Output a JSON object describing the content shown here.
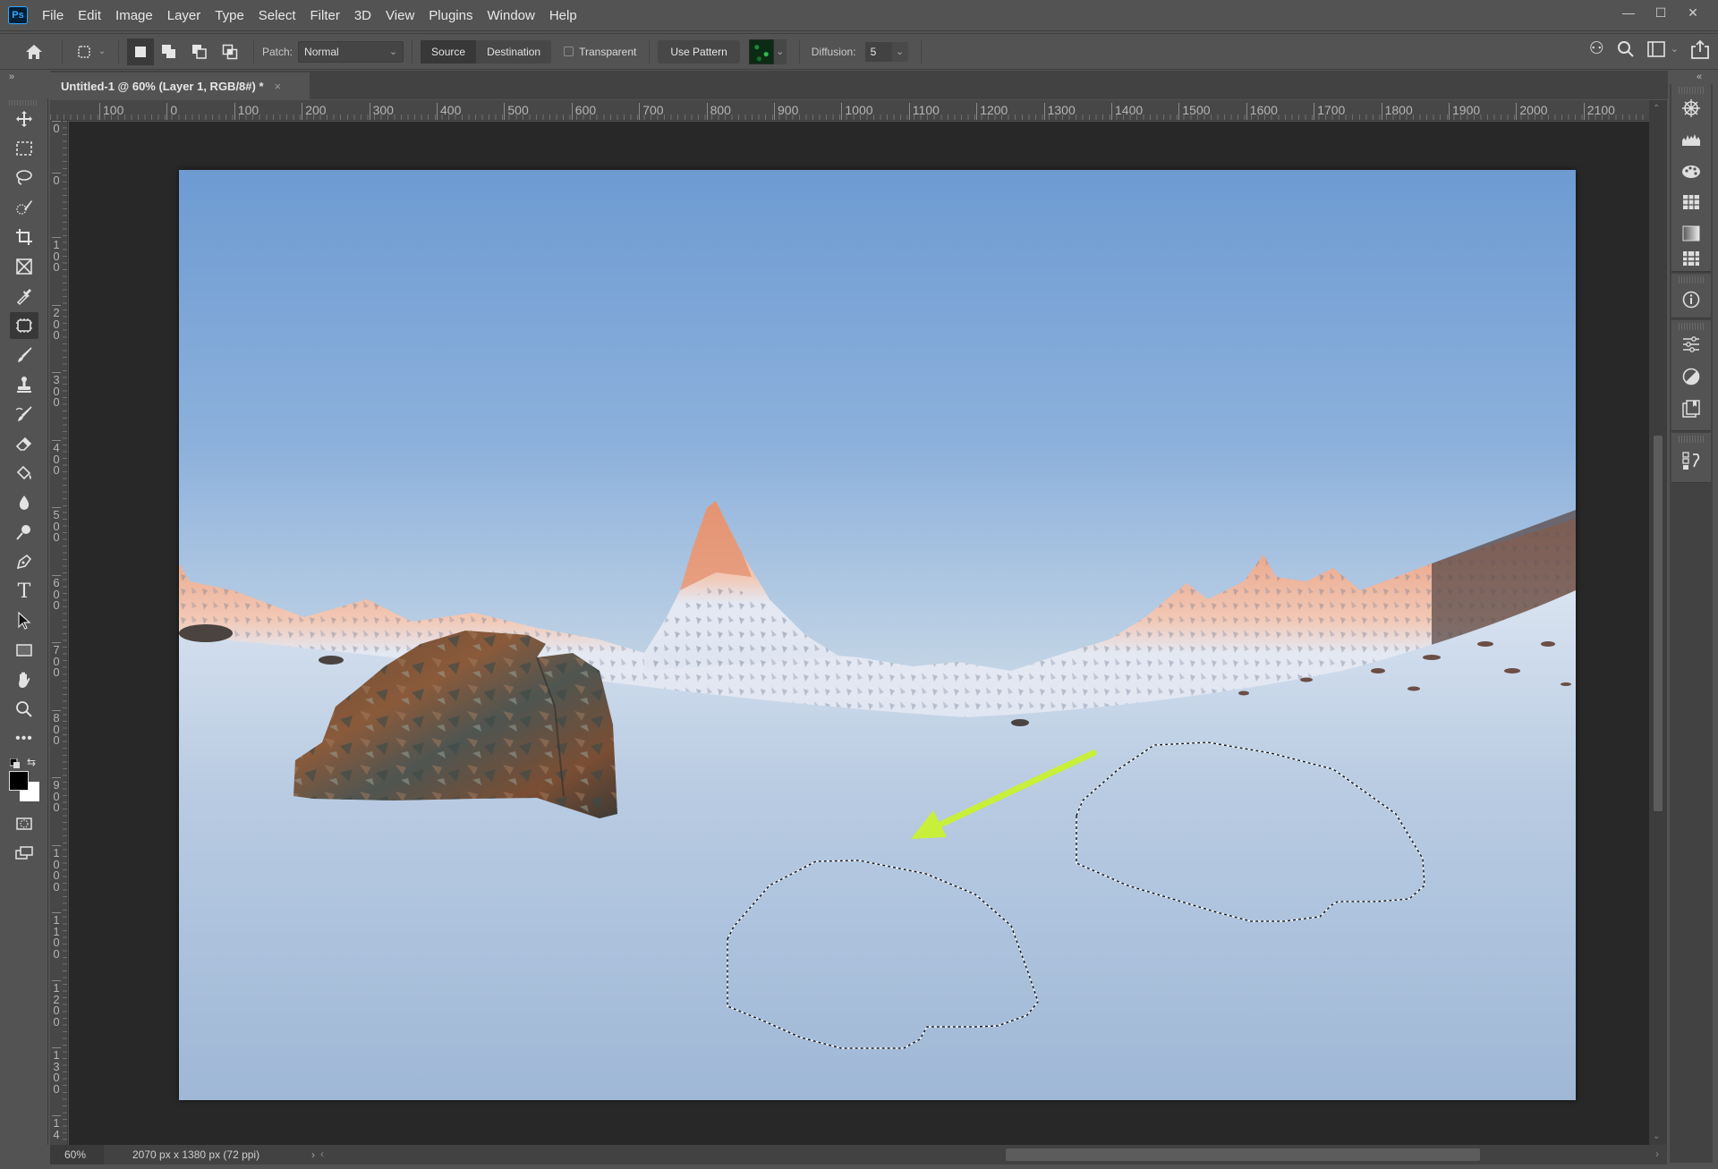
{
  "app": {
    "logo_text": "Ps",
    "menu": [
      "File",
      "Edit",
      "Image",
      "Layer",
      "Type",
      "Select",
      "Filter",
      "3D",
      "View",
      "Plugins",
      "Window",
      "Help"
    ],
    "window_controls": {
      "minimize": "—",
      "maximize": "☐",
      "close": "✕"
    }
  },
  "options_bar": {
    "patch_label": "Patch:",
    "patch_mode": "Normal",
    "source_label": "Source",
    "destination_label": "Destination",
    "transparent_label": "Transparent",
    "transparent_checked": false,
    "use_pattern_label": "Use Pattern",
    "diffusion_label": "Diffusion:",
    "diffusion_value": "5",
    "active_patch_target": "Source"
  },
  "document": {
    "tab_title": "Untitled-1 @ 60% (Layer 1, RGB/8#) *",
    "tab_close": "×",
    "zoom": "60%",
    "info": "2070 px x 1380 px (72 ppi)"
  },
  "rulers": {
    "horizontal": [
      "100",
      "0",
      "100",
      "200",
      "300",
      "400",
      "500",
      "600",
      "700",
      "800",
      "900",
      "1000",
      "1100",
      "1200",
      "1300",
      "1400",
      "1500",
      "1600",
      "1700",
      "1800",
      "1900",
      "2000",
      "2100"
    ],
    "vertical": [
      "0",
      "0",
      "100",
      "200",
      "300",
      "400",
      "500",
      "600",
      "700",
      "800",
      "900",
      "1000",
      "1100",
      "1200",
      "1300",
      "14"
    ]
  },
  "toolbar": {
    "tools": [
      "move",
      "rectangular-marquee",
      "lasso",
      "object-selection",
      "crop",
      "frame",
      "eyedropper",
      "patch",
      "brush",
      "clone-stamp",
      "history-brush",
      "eraser",
      "paint-bucket",
      "blur",
      "dodge",
      "pen",
      "type",
      "path-selection",
      "rectangle",
      "hand",
      "zoom",
      "more-tools"
    ],
    "active_tool": "patch",
    "foreground_color": "#000000",
    "background_color": "#ffffff"
  },
  "right_panel": {
    "icons": [
      "color-wheel",
      "histogram",
      "swatches",
      "grid-table",
      "gradients",
      "patterns",
      "info",
      "adjustments",
      "properties-half-circle",
      "libraries",
      "history"
    ]
  },
  "canvas": {
    "annotation_arrow_color": "#c8ef3a",
    "selections": 2
  }
}
